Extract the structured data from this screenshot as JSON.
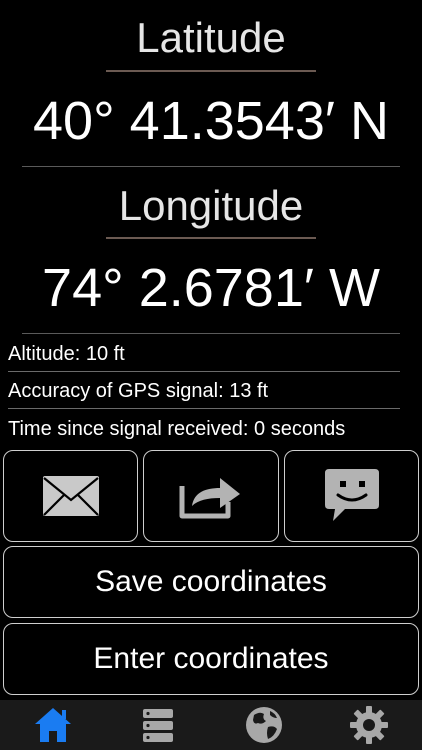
{
  "latitude": {
    "label": "Latitude",
    "value": "40° 41.3543′ N"
  },
  "longitude": {
    "label": "Longitude",
    "value": "74° 2.6781′ W"
  },
  "info": {
    "altitude": "Altitude: 10 ft",
    "accuracy": "Accuracy of GPS signal:  13 ft",
    "time_since": "Time since signal received: 0 seconds"
  },
  "actions": {
    "icons": [
      "envelope-icon",
      "share-icon",
      "message-bubble-icon"
    ],
    "save_label": "Save coordinates",
    "enter_label": "Enter coordinates"
  },
  "tabbar": {
    "tabs": [
      "home-icon",
      "list-icon",
      "globe-icon",
      "gear-icon"
    ],
    "active_index": 0,
    "active_color": "#1a7cf2",
    "inactive_color": "#a8a8a8"
  },
  "colors": {
    "background": "#000000",
    "text": "#ffffff",
    "icon_gray": "#b3b3b3"
  }
}
